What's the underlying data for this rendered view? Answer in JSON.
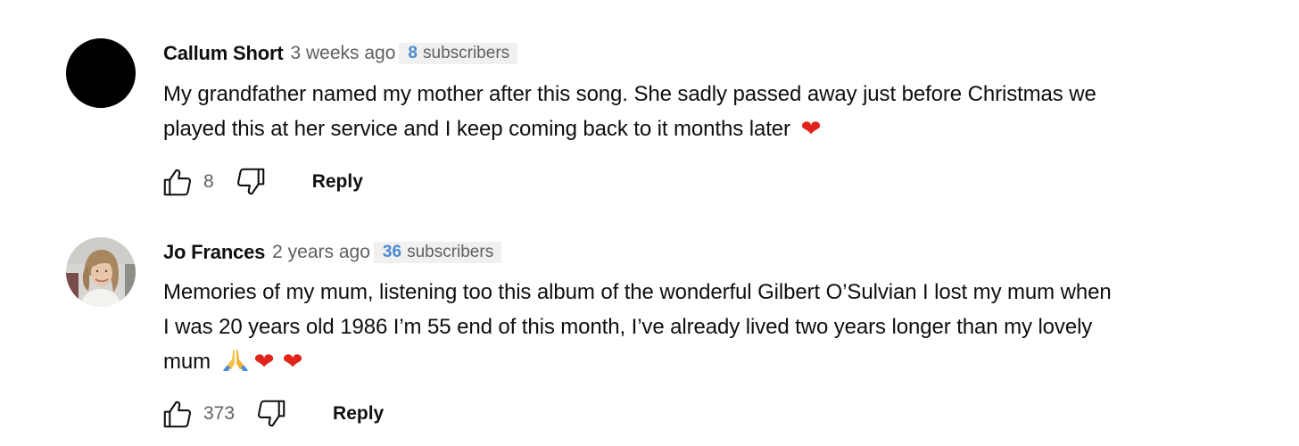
{
  "comments": [
    {
      "author": "Callum Short",
      "time": "3 weeks ago",
      "subscriber_count": "8",
      "subscriber_label": "subscribers",
      "text_line1": "My grandfather named my mother after this song. She sadly passed away just before Christmas we",
      "text_line2": "played this at her service and I keep coming back to it months later",
      "likes": "8",
      "reply_label": "Reply",
      "avatar_icon": "black-circle-avatar"
    },
    {
      "author": "Jo Frances",
      "time": "2 years ago",
      "subscriber_count": "36",
      "subscriber_label": "subscribers",
      "text_line1": "Memories of my mum, listening too this album of the wonderful Gilbert O’Sulvian I lost my mum when",
      "text_line2": "I was 20 years old 1986 I’m 55 end of this month, I’ve already lived two years longer than my lovely",
      "text_line3": "mum",
      "likes": "373",
      "reply_label": "Reply",
      "avatar_icon": "woman-photo-avatar"
    }
  ],
  "colors": {
    "subscriber_count": "#4a8bd1",
    "secondary_text": "#606060",
    "badge_background": "#f0f0f0",
    "heart": "#e2231a"
  },
  "icons": {
    "like": "thumbs-up-icon",
    "dislike": "thumbs-down-icon",
    "heart": "red-heart-emoji",
    "pray": "folded-hands-emoji"
  }
}
